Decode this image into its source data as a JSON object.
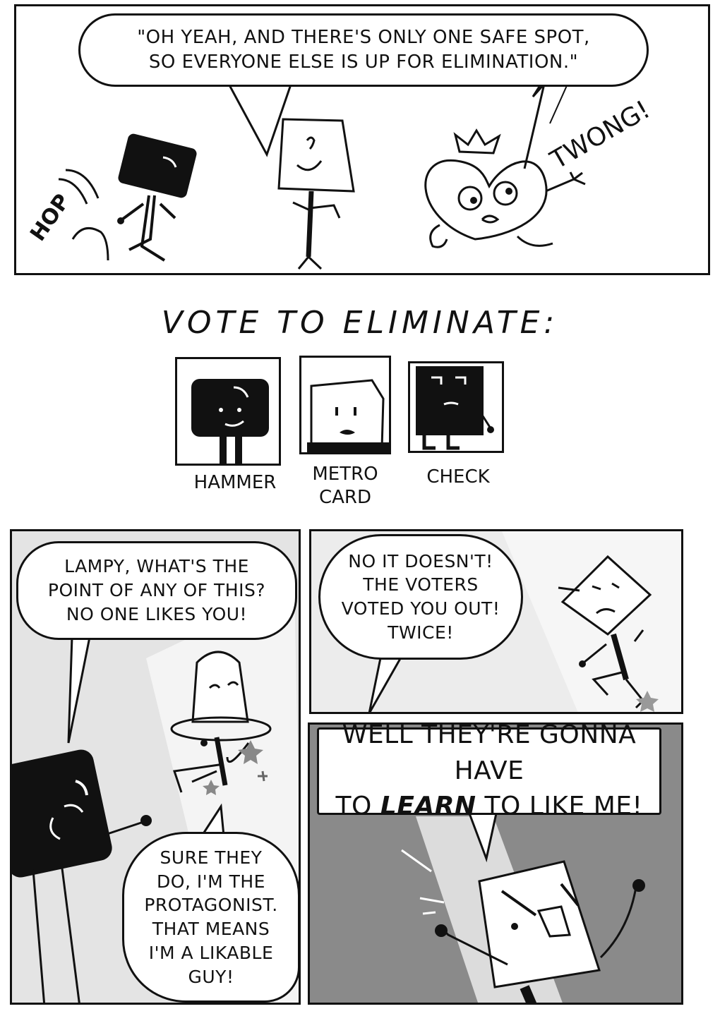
{
  "panel_1": {
    "speech": "\"OH YEAH, AND THERE'S ONLY ONE SAFE SPOT,\nSO EVERYONE ELSE IS UP FOR ELIMINATION.\"",
    "sfx_hop": "HOP",
    "sfx_twong": "TWONG!"
  },
  "vote": {
    "title": "VOTE TO ELIMINATE:",
    "candidates": [
      {
        "label": "HAMMER"
      },
      {
        "label": "METRO\nCARD"
      },
      {
        "label": "CHECK"
      }
    ]
  },
  "panel_2": {
    "speech_top": "LAMPY, WHAT'S THE\nPOINT OF ANY OF THIS?\nNO ONE LIKES YOU!",
    "speech_bottom": "SURE THEY\nDO, I'M THE\nPROTAGONIST.\nTHAT MEANS\nI'M A LIKABLE\nGUY!"
  },
  "panel_3": {
    "speech": "NO IT DOESN'T!\nTHE VOTERS\nVOTED YOU OUT!\nTWICE!"
  },
  "panel_4": {
    "speech_part1": "WELL THEY'RE GONNA HAVE",
    "speech_part2a": "TO ",
    "speech_emphasis": "LEARN",
    "speech_part2b": " TO LIKE ME!"
  }
}
